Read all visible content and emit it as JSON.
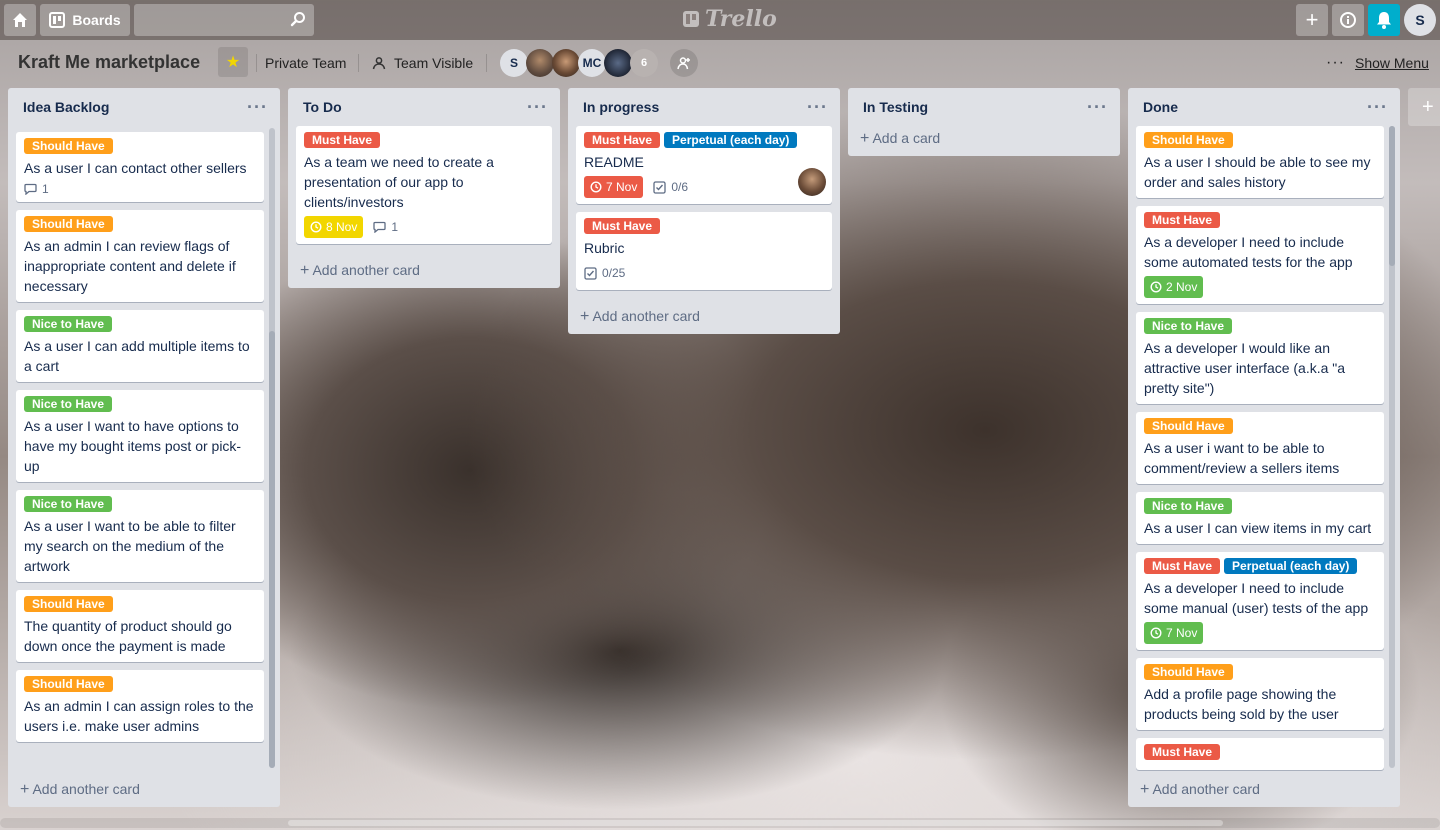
{
  "header": {
    "boards_label": "Boards",
    "search_placeholder": "",
    "logo_text": "Trello",
    "user_initial": "S"
  },
  "board": {
    "title": "Kraft Me marketplace",
    "team": "Private Team",
    "visibility": "Team Visible",
    "members": [
      "S",
      "MC"
    ],
    "member_count_extra": "6",
    "show_menu": "Show Menu"
  },
  "colors": {
    "should_have": "#ff9f1a",
    "must_have": "#eb5a46",
    "nice_to_have": "#61bd4f",
    "perpetual": "#0079bf"
  },
  "lists": [
    {
      "title": "Idea Backlog",
      "add_label": "Add another card",
      "cards": [
        {
          "labels": [
            "Should Have"
          ],
          "title": "As a user I can contact other sellers",
          "comments": "1"
        },
        {
          "labels": [
            "Should Have"
          ],
          "title": "As an admin I can review flags of inappropriate content and delete if necessary"
        },
        {
          "labels": [
            "Nice to Have"
          ],
          "title": "As a user I can add multiple items to a cart"
        },
        {
          "labels": [
            "Nice to Have"
          ],
          "title": "As a user I want to have options to have my bought items post or pick-up"
        },
        {
          "labels": [
            "Nice to Have"
          ],
          "title": "As a user I want to be able to filter my search on the medium of the artwork"
        },
        {
          "labels": [
            "Should Have"
          ],
          "title": "The quantity of product should go down once the payment is made"
        },
        {
          "labels": [
            "Should Have"
          ],
          "title": "As an admin I can assign roles to the users i.e. make user admins"
        }
      ]
    },
    {
      "title": "To Do",
      "add_label": "Add another card",
      "cards": [
        {
          "labels": [
            "Must Have"
          ],
          "title": "As a team we need to create a presentation of our app to clients/investors",
          "due": "8 Nov",
          "comments": "1"
        }
      ]
    },
    {
      "title": "In progress",
      "add_label": "Add another card",
      "cards": [
        {
          "labels": [
            "Must Have",
            "Perpetual (each day)"
          ],
          "title": "README",
          "due": "7 Nov",
          "checklist": "0/6"
        },
        {
          "labels": [
            "Must Have"
          ],
          "title": "Rubric",
          "checklist": "0/25"
        }
      ]
    },
    {
      "title": "In Testing",
      "add_label": "Add a card",
      "cards": []
    },
    {
      "title": "Done",
      "add_label": "Add another card",
      "cards": [
        {
          "labels": [
            "Should Have"
          ],
          "title": "As a user I should be able to see my order and sales history"
        },
        {
          "labels": [
            "Must Have"
          ],
          "title": "As a developer I need to include some automated tests for the app",
          "due": "2 Nov"
        },
        {
          "labels": [
            "Nice to Have"
          ],
          "title": "As a developer I would like an attractive user interface (a.k.a \"a pretty site\")"
        },
        {
          "labels": [
            "Should Have"
          ],
          "title": "As a user i want to be able to comment/review a sellers items"
        },
        {
          "labels": [
            "Nice to Have"
          ],
          "title": "As a user I can view items in my cart"
        },
        {
          "labels": [
            "Must Have",
            "Perpetual (each day)"
          ],
          "title": "As a developer I need to include some manual (user) tests of the app",
          "due": "7 Nov"
        },
        {
          "labels": [
            "Should Have"
          ],
          "title": "Add a profile page showing the products being sold by the user"
        },
        {
          "labels": [
            "Must Have"
          ],
          "title": ""
        }
      ]
    }
  ]
}
